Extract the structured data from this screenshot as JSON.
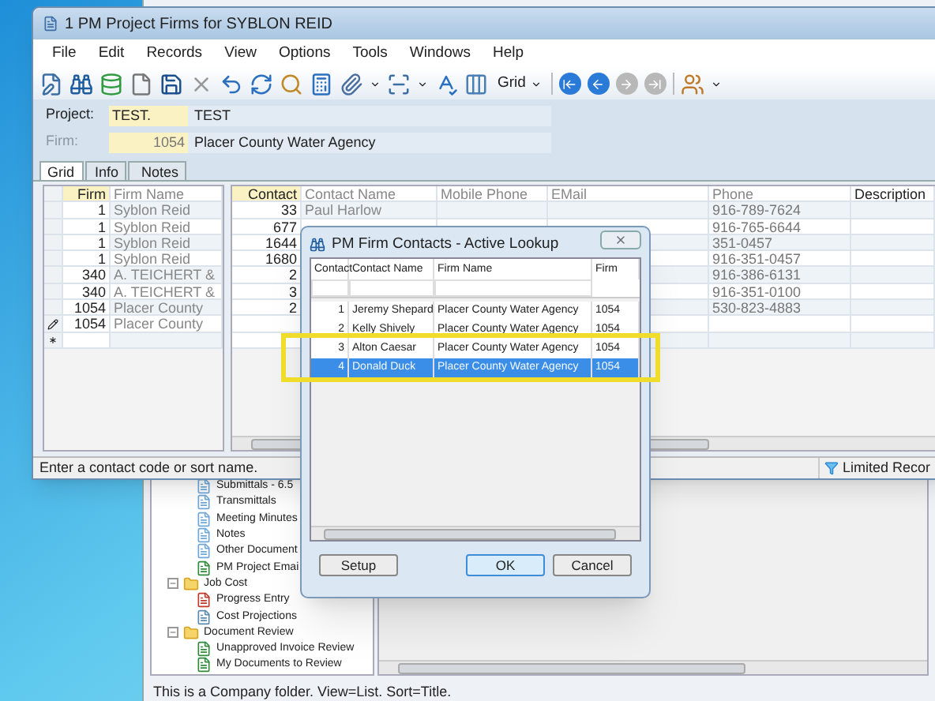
{
  "back_window": {
    "tree": [
      {
        "label": "Submittals - 6.5",
        "kind": "document"
      },
      {
        "label": "Transmittals",
        "kind": "document"
      },
      {
        "label": "Meeting Minutes",
        "kind": "document"
      },
      {
        "label": "Notes",
        "kind": "document"
      },
      {
        "label": "Other Document",
        "kind": "document"
      },
      {
        "label": "PM Project Emai",
        "kind": "email"
      },
      {
        "label": "Job Cost",
        "kind": "folder",
        "expanded": true,
        "children": [
          {
            "label": "Progress Entry",
            "kind": "progress"
          },
          {
            "label": "Cost Projections",
            "kind": "projection"
          }
        ]
      },
      {
        "label": "Document Review",
        "kind": "folder",
        "expanded": true,
        "children": [
          {
            "label": "Unapproved Invoice Review",
            "kind": "email"
          },
          {
            "label": "My Documents to Review",
            "kind": "email"
          }
        ]
      }
    ],
    "status_bar": "This is a Company folder. View=List. Sort=Title."
  },
  "window": {
    "title": "1 PM Project Firms for SYBLON REID"
  },
  "menu": [
    "File",
    "Edit",
    "Records",
    "View",
    "Options",
    "Tools",
    "Windows",
    "Help"
  ],
  "toolbar": {
    "view_label": "Grid"
  },
  "fields": [
    {
      "label": "Project:",
      "value": "TEST.",
      "description": "TEST",
      "disabled": false
    },
    {
      "label": "Firm:",
      "value": "1054",
      "description": "Placer County Water Agency",
      "disabled": true
    }
  ],
  "tabs": [
    {
      "label": "Grid",
      "selected": true
    },
    {
      "label": "Info",
      "selected": false
    },
    {
      "label": "Notes",
      "selected": false
    }
  ],
  "firm_grid": {
    "columns": [
      "Firm",
      "Firm Name"
    ],
    "rows": [
      {
        "kind": "record",
        "firm": "1",
        "firm_name": "Syblon Reid"
      },
      {
        "kind": "record",
        "firm": "1",
        "firm_name": "Syblon Reid"
      },
      {
        "kind": "record",
        "firm": "1",
        "firm_name": "Syblon Reid"
      },
      {
        "kind": "record",
        "firm": "1",
        "firm_name": "Syblon Reid"
      },
      {
        "kind": "record",
        "firm": "340",
        "firm_name": "A. TEICHERT &"
      },
      {
        "kind": "record",
        "firm": "340",
        "firm_name": "A. TEICHERT &"
      },
      {
        "kind": "record",
        "firm": "1054",
        "firm_name": "Placer County"
      },
      {
        "kind": "editing",
        "firm": "1054",
        "firm_name": "Placer County"
      },
      {
        "kind": "new"
      }
    ]
  },
  "contact_grid": {
    "columns": [
      "Contact",
      "Contact Name",
      "Mobile Phone",
      "EMail",
      "Phone",
      "Description"
    ],
    "rows": [
      {
        "contact": "33",
        "contact_name": "Paul   Harlow",
        "phone": "916-789-7624"
      },
      {
        "contact": "677",
        "phone": "916-765-6644"
      },
      {
        "contact": "1644",
        "phone": "351-0457"
      },
      {
        "contact": "1680",
        "phone": "916-351-0457"
      },
      {
        "contact": "2",
        "phone": "916-386-6131"
      },
      {
        "contact": "3",
        "phone": "916-351-0100"
      },
      {
        "contact": "2",
        "phone": "530-823-4883"
      }
    ]
  },
  "status_bar": {
    "message": "Enter a contact code or sort name.",
    "filter": "Limited Recor"
  },
  "dialog": {
    "title": "PM Firm Contacts - Active Lookup",
    "columns": [
      "Contact",
      "Contact Name",
      "Firm Name",
      "Firm"
    ],
    "rows": [
      {
        "contact": "1",
        "contact_name": "Jeremy   Shepard",
        "firm_name": "Placer County Water Agency",
        "firm": "1054",
        "selected": false
      },
      {
        "contact": "2",
        "contact_name": "Kelly   Shively",
        "firm_name": "Placer County Water Agency",
        "firm": "1054",
        "selected": false
      },
      {
        "contact": "3",
        "contact_name": "Alton   Caesar",
        "firm_name": "Placer County Water Agency",
        "firm": "1054",
        "selected": false
      },
      {
        "contact": "4",
        "contact_name": "Donald   Duck",
        "firm_name": "Placer County Water Agency",
        "firm": "1054",
        "selected": true
      }
    ],
    "buttons": [
      {
        "label": "Setup",
        "default": false
      },
      {
        "label": "OK",
        "default": true
      },
      {
        "label": "Cancel",
        "default": false
      }
    ]
  }
}
